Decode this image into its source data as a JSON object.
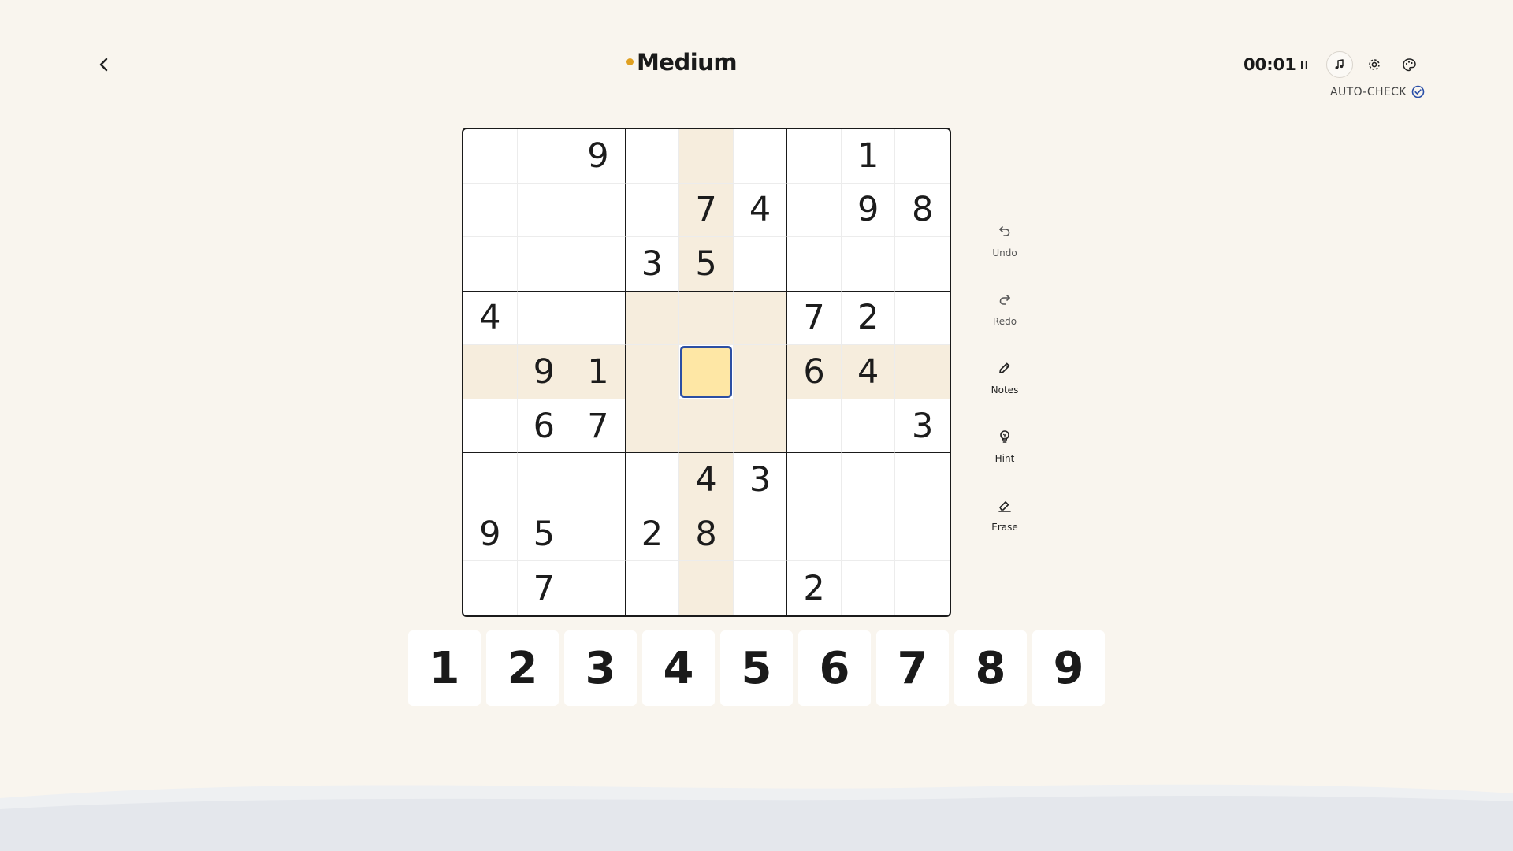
{
  "header": {
    "difficulty": "Medium",
    "timer": "00:01",
    "auto_check_label": "AUTO-CHECK"
  },
  "icons": {
    "back": "chevron-left-icon",
    "pause": "pause-icon",
    "music": "music-note-icon",
    "settings": "gear-icon",
    "theme": "palette-icon",
    "auto_check": "check-circle-icon"
  },
  "colors": {
    "background": "#f9f5ee",
    "difficulty_dot": "#e0a020",
    "highlight": "#f6eddd",
    "selected_fill": "#fee7a5",
    "selected_border": "#2c4fa3",
    "accent_blue": "#2a4fa8"
  },
  "board": {
    "selected_cell": {
      "row": 5,
      "col": 5
    },
    "rows": [
      [
        "",
        "",
        "9",
        "",
        "",
        "",
        "",
        "1",
        ""
      ],
      [
        "",
        "",
        "",
        "",
        "7",
        "4",
        "",
        "9",
        "8"
      ],
      [
        "",
        "",
        "",
        "3",
        "5",
        "",
        "",
        "",
        ""
      ],
      [
        "4",
        "",
        "",
        "",
        "",
        "",
        "7",
        "2",
        ""
      ],
      [
        "",
        "9",
        "1",
        "",
        "",
        "",
        "6",
        "4",
        ""
      ],
      [
        "",
        "6",
        "7",
        "",
        "",
        "",
        "",
        "",
        "3"
      ],
      [
        "",
        "",
        "",
        "",
        "4",
        "3",
        "",
        "",
        ""
      ],
      [
        "9",
        "5",
        "",
        "2",
        "8",
        "",
        "",
        "",
        ""
      ],
      [
        "",
        "7",
        "",
        "",
        "",
        "",
        "2",
        "",
        ""
      ]
    ]
  },
  "tools": [
    {
      "label": "Undo",
      "icon": "undo-icon"
    },
    {
      "label": "Redo",
      "icon": "redo-icon"
    },
    {
      "label": "Notes",
      "icon": "pencil-icon"
    },
    {
      "label": "Hint",
      "icon": "lightbulb-icon"
    },
    {
      "label": "Erase",
      "icon": "eraser-icon"
    }
  ],
  "number_pad": [
    "1",
    "2",
    "3",
    "4",
    "5",
    "6",
    "7",
    "8",
    "9"
  ]
}
